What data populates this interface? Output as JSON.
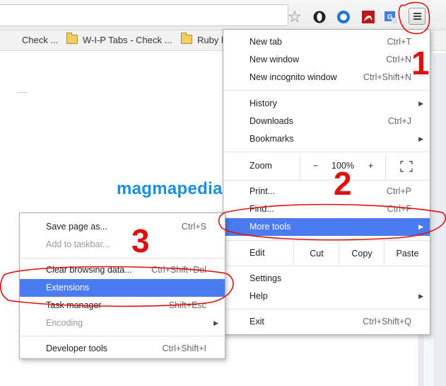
{
  "toolbar": {
    "icons": [
      "bookmark-star-icon",
      "opera-extension-icon",
      "circle-extension-icon",
      "pdf-extension-icon",
      "translate-extension-icon",
      "chrome-menu-icon"
    ],
    "translate_badge": "G"
  },
  "bookmarks": [
    {
      "label": "Check ...",
      "folder": false
    },
    {
      "label": "W-I-P Tabs - Check ...",
      "folder": true
    },
    {
      "label": "Ruby l",
      "folder": true
    }
  ],
  "main_menu": {
    "new_tab": {
      "label": "New tab",
      "shortcut": "Ctrl+T"
    },
    "new_window": {
      "label": "New window",
      "shortcut": "Ctrl+N"
    },
    "new_incognito": {
      "label": "New incognito window",
      "shortcut": "Ctrl+Shift+N"
    },
    "history": {
      "label": "History"
    },
    "downloads": {
      "label": "Downloads",
      "shortcut": "Ctrl+J"
    },
    "bookmarks": {
      "label": "Bookmarks"
    },
    "zoom": {
      "label": "Zoom",
      "minus": "−",
      "value": "100%",
      "plus": "+"
    },
    "print": {
      "label": "Print...",
      "shortcut": "Ctrl+P"
    },
    "find": {
      "label": "Find...",
      "shortcut": "Ctrl+F"
    },
    "more_tools": {
      "label": "More tools"
    },
    "edit": {
      "label": "Edit",
      "cut": "Cut",
      "copy": "Copy",
      "paste": "Paste"
    },
    "settings": {
      "label": "Settings"
    },
    "help": {
      "label": "Help"
    },
    "exit": {
      "label": "Exit",
      "shortcut": "Ctrl+Shift+Q"
    }
  },
  "sub_menu": {
    "save_page": {
      "label": "Save page as...",
      "shortcut": "Ctrl+S"
    },
    "add_taskbar": {
      "label": "Add to taskbar..."
    },
    "clear_browsing": {
      "label": "Clear browsing data...",
      "shortcut": "Ctrl+Shift+Del"
    },
    "extensions": {
      "label": "Extensions"
    },
    "task_manager": {
      "label": "Task manager",
      "shortcut": "Shift+Esc"
    },
    "encoding": {
      "label": "Encoding"
    },
    "developer_tools": {
      "label": "Developer tools",
      "shortcut": "Ctrl+Shift+I"
    }
  },
  "annotations": {
    "step1": "1",
    "step2": "2",
    "step3": "3",
    "watermark": "magmapedia"
  },
  "colors": {
    "highlight": "#4a7cf0",
    "annotation": "#e01010",
    "watermark": "#1a8fe0"
  }
}
